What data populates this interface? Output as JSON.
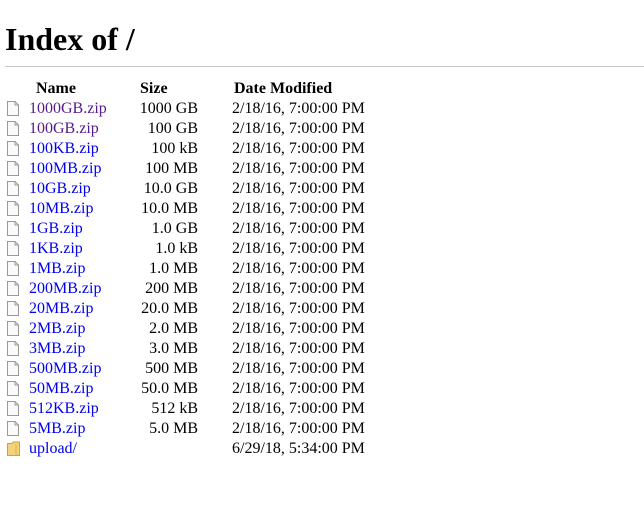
{
  "title": "Index of /",
  "headers": {
    "name": "Name",
    "size": "Size",
    "date": "Date Modified"
  },
  "entries": [
    {
      "name": "1000GB.zip",
      "size": "1000 GB",
      "date": "2/18/16, 7:00:00 PM",
      "type": "file"
    },
    {
      "name": "100GB.zip",
      "size": "100 GB",
      "date": "2/18/16, 7:00:00 PM",
      "type": "file"
    },
    {
      "name": "100KB.zip",
      "size": "100 kB",
      "date": "2/18/16, 7:00:00 PM",
      "type": "file"
    },
    {
      "name": "100MB.zip",
      "size": "100 MB",
      "date": "2/18/16, 7:00:00 PM",
      "type": "file"
    },
    {
      "name": "10GB.zip",
      "size": "10.0 GB",
      "date": "2/18/16, 7:00:00 PM",
      "type": "file"
    },
    {
      "name": "10MB.zip",
      "size": "10.0 MB",
      "date": "2/18/16, 7:00:00 PM",
      "type": "file"
    },
    {
      "name": "1GB.zip",
      "size": "1.0 GB",
      "date": "2/18/16, 7:00:00 PM",
      "type": "file"
    },
    {
      "name": "1KB.zip",
      "size": "1.0 kB",
      "date": "2/18/16, 7:00:00 PM",
      "type": "file"
    },
    {
      "name": "1MB.zip",
      "size": "1.0 MB",
      "date": "2/18/16, 7:00:00 PM",
      "type": "file"
    },
    {
      "name": "200MB.zip",
      "size": "200 MB",
      "date": "2/18/16, 7:00:00 PM",
      "type": "file"
    },
    {
      "name": "20MB.zip",
      "size": "20.0 MB",
      "date": "2/18/16, 7:00:00 PM",
      "type": "file"
    },
    {
      "name": "2MB.zip",
      "size": "2.0 MB",
      "date": "2/18/16, 7:00:00 PM",
      "type": "file"
    },
    {
      "name": "3MB.zip",
      "size": "3.0 MB",
      "date": "2/18/16, 7:00:00 PM",
      "type": "file"
    },
    {
      "name": "500MB.zip",
      "size": "500 MB",
      "date": "2/18/16, 7:00:00 PM",
      "type": "file"
    },
    {
      "name": "50MB.zip",
      "size": "50.0 MB",
      "date": "2/18/16, 7:00:00 PM",
      "type": "file"
    },
    {
      "name": "512KB.zip",
      "size": "512 kB",
      "date": "2/18/16, 7:00:00 PM",
      "type": "file"
    },
    {
      "name": "5MB.zip",
      "size": "5.0 MB",
      "date": "2/18/16, 7:00:00 PM",
      "type": "file"
    },
    {
      "name": "upload/",
      "size": "",
      "date": "6/29/18, 5:34:00 PM",
      "type": "folder"
    }
  ]
}
